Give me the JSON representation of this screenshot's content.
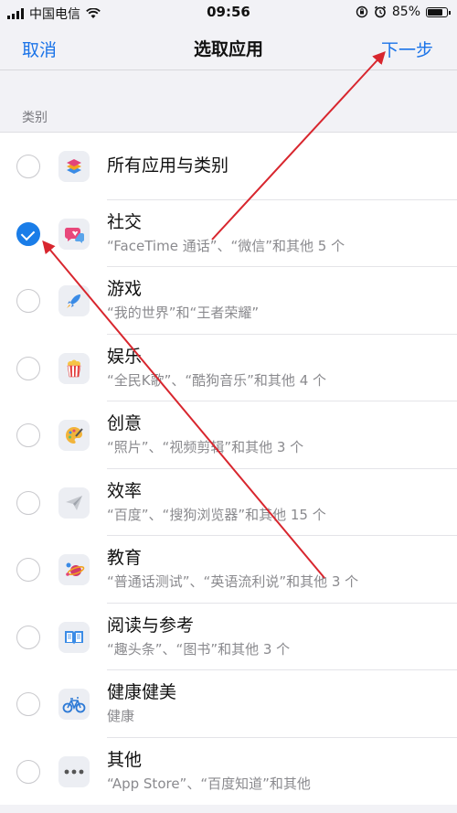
{
  "status_bar": {
    "carrier": "中国电信",
    "time": "09:56",
    "battery": "85%",
    "battery_level": 0.85
  },
  "nav": {
    "cancel": "取消",
    "title": "选取应用",
    "next": "下一步"
  },
  "section": {
    "title": "类别"
  },
  "categories": [
    {
      "title": "所有应用与类别",
      "subtitle": "",
      "checked": false,
      "icon": "stack-icon"
    },
    {
      "title": "社交",
      "subtitle": "“FaceTime 通话”、“微信”和其他 5 个",
      "checked": true,
      "icon": "chat-bubble-icon"
    },
    {
      "title": "游戏",
      "subtitle": "“我的世界”和“王者荣耀”",
      "checked": false,
      "icon": "rocket-icon"
    },
    {
      "title": "娱乐",
      "subtitle": "“全民K歌”、“酷狗音乐”和其他 4 个",
      "checked": false,
      "icon": "popcorn-icon"
    },
    {
      "title": "创意",
      "subtitle": "“照片”、“视频剪辑”和其他 3 个",
      "checked": false,
      "icon": "palette-icon"
    },
    {
      "title": "效率",
      "subtitle": "“百度”、“搜狗浏览器”和其他 15 个",
      "checked": false,
      "icon": "paper-plane-icon"
    },
    {
      "title": "教育",
      "subtitle": "“普通话测试”、“英语流利说”和其他 3 个",
      "checked": false,
      "icon": "planet-icon"
    },
    {
      "title": "阅读与参考",
      "subtitle": "“趣头条”、“图书”和其他 3 个",
      "checked": false,
      "icon": "book-icon"
    },
    {
      "title": "健康健美",
      "subtitle": "健康",
      "checked": false,
      "icon": "bicycle-icon"
    },
    {
      "title": "其他",
      "subtitle": "“App Store”、“百度知道”和其他",
      "checked": false,
      "icon": "ellipsis-icon"
    }
  ],
  "colors": {
    "accent": "#1a73e8",
    "annotation": "#d8262e"
  }
}
